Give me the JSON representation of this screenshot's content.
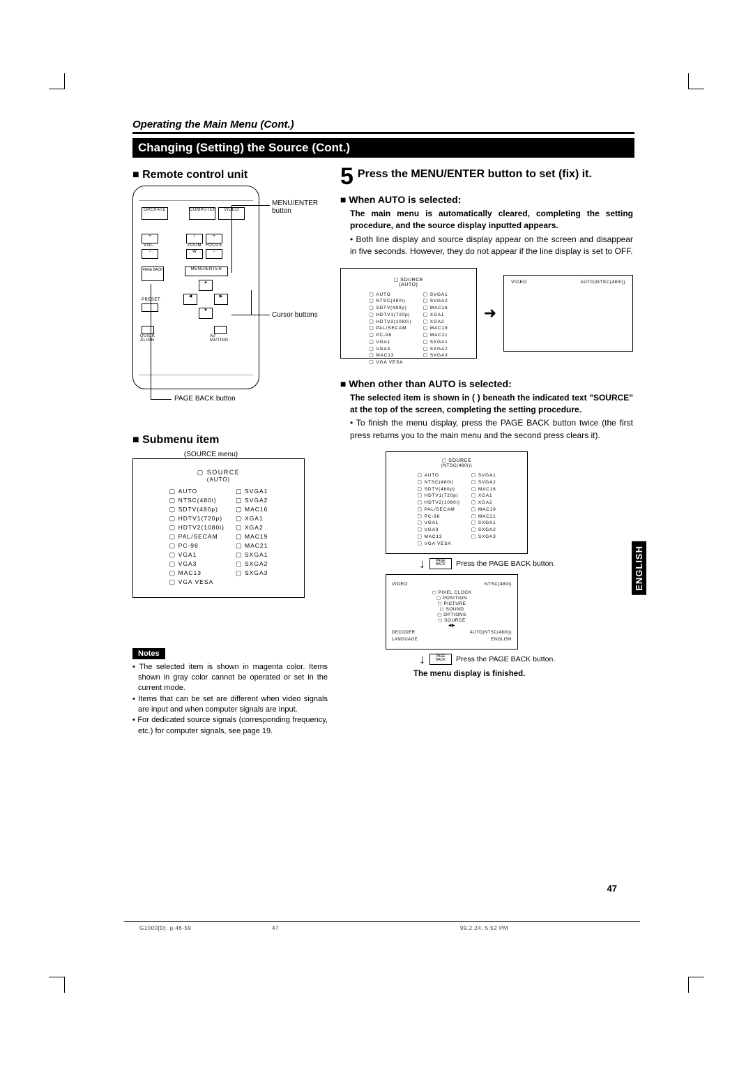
{
  "pageHeaderTitle": "Operating the Main Menu (Cont.)",
  "sectionBanner": "Changing (Setting) the Source (Cont.)",
  "colLeft": {
    "remoteHeading": "Remote control unit",
    "submenuHeading": "Submenu item",
    "labels": {
      "menuEnter": "MENU/ENTER button",
      "cursor": "Cursor buttons",
      "pageBack": "PAGE BACK button",
      "sourceMenuCaption": "(SOURCE menu)"
    },
    "remoteButtons": {
      "operate": "OPERATE",
      "computer": "COMPUTER",
      "video": "VIDEO",
      "volPlus": "+",
      "volMinus": "−",
      "vol": "VOL.",
      "zoomT": "T",
      "zoomW": "W",
      "zoom": "ZOOM",
      "focusPlus": "+",
      "focusMinus": "−",
      "focus": "FOCUS",
      "pageBack": "PAGE\nBACK",
      "menuEnter": "MENU/ENTER",
      "preset": "PRESET",
      "quickAlign": "QUICK\nALIGN.",
      "avMuting": "AV\nMUTING"
    },
    "sourceMenu": {
      "title": "SOURCE",
      "subtitle": "(AUTO)",
      "left": [
        "AUTO",
        "NTSC(480i)",
        "SDTV(480p)",
        "HDTV1(720p)",
        "HDTV2(1080i)",
        "PAL/SECAM",
        "PC-98",
        "VGA1",
        "VGA3",
        "MAC13",
        "VGA VESA"
      ],
      "right": [
        "SVGA1",
        "SVGA2",
        "MAC16",
        "XGA1",
        "XGA2",
        "MAC19",
        "MAC21",
        "SXGA1",
        "SXGA2",
        "SXGA3"
      ]
    }
  },
  "colRight": {
    "step": {
      "num": "5",
      "text": "Press the MENU/ENTER button to set (fix) it."
    },
    "autoHead": "When AUTO is selected:",
    "autoBold": "The main menu is automatically cleared, completing the setting procedure, and the source display inputted appears.",
    "autoBullet": "Both line display and source display appear on the screen and disappear in five seconds. However, they do not appear if the line display is set to OFF.",
    "videoLabel": "VIDEO",
    "autoNtsc": "AUTO(NTSC(480i))",
    "otherHead": "When other than AUTO is selected:",
    "otherBold": "The selected item is shown in (   ) beneath the indicated text \"SOURCE\" at the top of the screen, completing the setting procedure.",
    "otherBullet": "To finish the menu display, press the PAGE BACK button twice (the first press returns you to the main menu and the second press clears it).",
    "otherSourceSub": "(NTSC(480i))",
    "pressPB": "Press the PAGE BACK button.",
    "pageBackLabel": "PAGE\nBACK",
    "mainMenu": {
      "left": "VIDEO",
      "right": "NTSC(480i)",
      "items": [
        "PIXEL CLOCK",
        "POSITION",
        "PICTURE",
        "SOUND",
        "OPTIONS",
        "SOURCE"
      ],
      "decoder": "DECODER",
      "decoderVal": "AUTO(NTSC(480i))",
      "language": "LANGUAGE",
      "languageVal": "ENGLISH",
      "arrows": "◀▶"
    },
    "finished": "The menu display is finished."
  },
  "notes": {
    "title": "Notes",
    "n1": "The selected item is shown in magenta color. Items shown in gray color cannot be operated or set in the current mode.",
    "n2": "Items that can be set are different when video signals are input and when computer signals are input.",
    "n3": "For dedicated source signals (corresponding frequency, etc.) for computer signals, see page 19."
  },
  "englishTab": "ENGLISH",
  "pageNum": "47",
  "footer": {
    "file": "G1000[D]. p.46-59",
    "mid": "47",
    "date": "99.2.24, 5:52 PM"
  }
}
